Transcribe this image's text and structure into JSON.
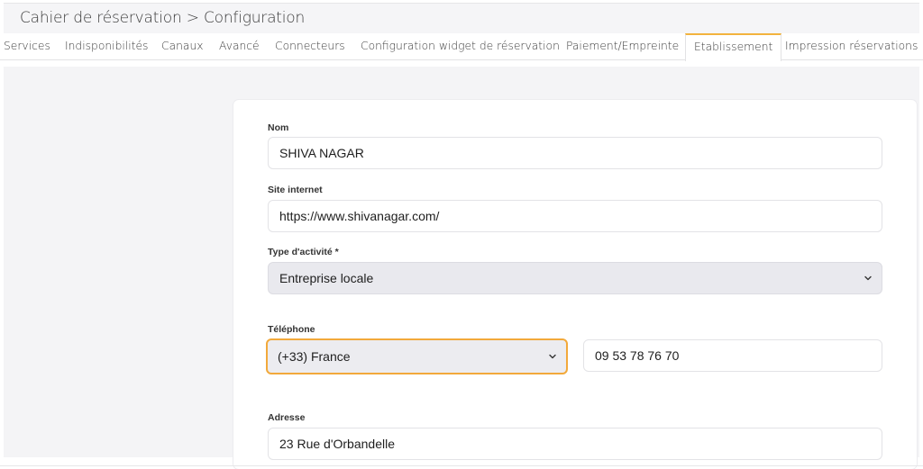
{
  "header": {
    "title": "Cahier de réservation > Configuration"
  },
  "tabs": [
    {
      "label": "Services"
    },
    {
      "label": "Indisponibilités"
    },
    {
      "label": "Canaux"
    },
    {
      "label": "Avancé"
    },
    {
      "label": "Connecteurs"
    },
    {
      "label": "Configuration widget de réservation"
    },
    {
      "label": "Paiement/Empreinte"
    },
    {
      "label": "Etablissement",
      "active": true
    },
    {
      "label": "Impression réservations"
    }
  ],
  "form": {
    "nom": {
      "label": "Nom",
      "value": "SHIVA NAGAR"
    },
    "site": {
      "label": "Site internet",
      "value": "https://www.shivanagar.com/"
    },
    "activite": {
      "label": "Type d'activité *",
      "value": "Entreprise locale"
    },
    "telephone": {
      "label": "Téléphone",
      "country": "(+33) France",
      "number": "09 53 78 76 70"
    },
    "adresse": {
      "label": "Adresse",
      "value": "23 Rue d'Orbandelle"
    }
  },
  "colors": {
    "accent": "#f2b33d",
    "focus_border": "#f2a93b",
    "page_bg": "#f4f4f6"
  },
  "icons": {
    "select_arrow": "chevron-down-icon"
  }
}
